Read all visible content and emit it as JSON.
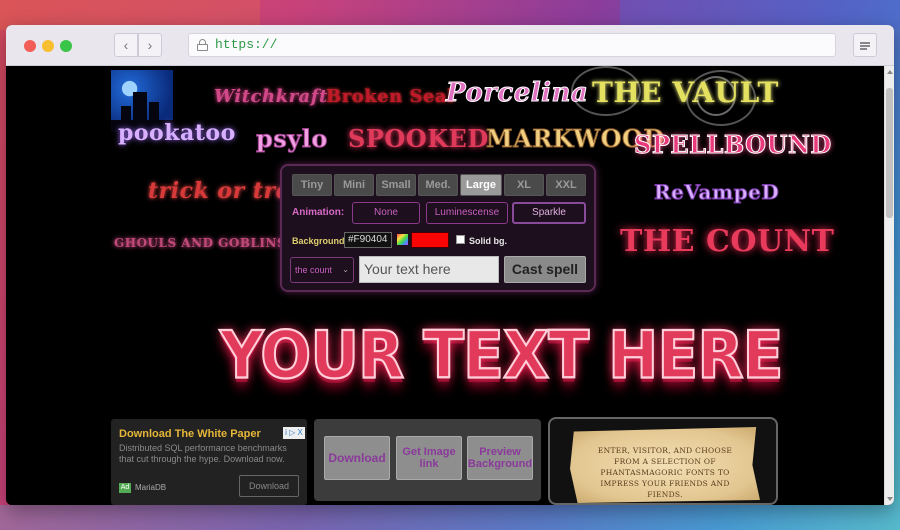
{
  "browser": {
    "url": "https://",
    "back_icon": "chevron-left-icon",
    "forward_icon": "chevron-right-icon",
    "menu_icon": "hamburger-icon"
  },
  "samples": {
    "witchkraft": "Witchkraft",
    "broken_seal": "Broken Seal",
    "porcelina": "Porcelina",
    "the_vault": "THE VAULT",
    "pookatoo": "pookatoo",
    "psylo": "psylo",
    "spooked": "SPOOKED",
    "markwood": "MARKWOOD",
    "spellbound": "SPELLBOUND",
    "trick_or_treat": "trick or treat",
    "revamped": "ReVampeD",
    "ghouls": "GHOULS AND GOBLINS",
    "the_count": "THE COUNT"
  },
  "controls": {
    "sizes": [
      "Tiny",
      "Mini",
      "Small",
      "Med.",
      "Large",
      "XL",
      "XXL"
    ],
    "active_size": "Large",
    "animation_label": "Animation:",
    "animations": [
      "None",
      "Luminescense",
      "Sparkle"
    ],
    "active_animation": "Sparkle",
    "background_label": "Background:",
    "background_hex": "#F90404",
    "background_color": "#f90404",
    "solid_label": "Solid bg.",
    "font_select": "the count",
    "text_placeholder": "Your text here",
    "cast_button": "Cast spell"
  },
  "preview": {
    "text": "YOUR TEXT HERE"
  },
  "ad": {
    "title": "Download The White Paper",
    "body": "Distributed SQL performance benchmarks that cut through the hype. Download now.",
    "badge": "Ad",
    "brand": "MariaDB",
    "button": "Download",
    "adchoices": "i ▷ X"
  },
  "actions": {
    "download": "Download",
    "get_link": "Get Image link",
    "preview_bg": "Preview Background"
  },
  "scroll_message": "Enter, visitor, and choose from a selection of phantasmagoric fonts to impress your friends and fiends."
}
